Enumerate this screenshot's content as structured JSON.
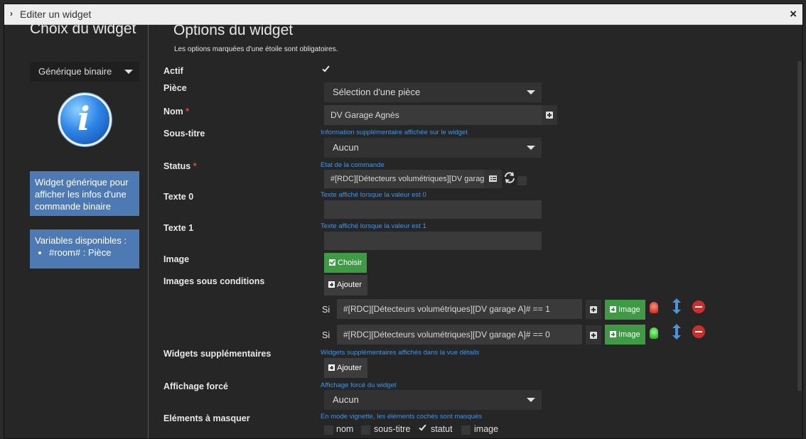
{
  "window": {
    "title": "Editer un widget"
  },
  "left": {
    "heading": "Choix du widget",
    "widget_select": "Générique binaire",
    "description": "Widget générique pour afficher les infos d'une commande binaire",
    "vars_title": "Variables disponibles :",
    "vars_item": "#room# : Pièce"
  },
  "main": {
    "heading": "Options du widget",
    "note": "Les options marquées d'une étoile sont obligatoires.",
    "actif_label": "Actif",
    "piece_label": "Pièce",
    "piece_value": "Sélection d'une pièce",
    "nom_label": "Nom",
    "nom_value": "DV Garage Agnès",
    "required_star": "*",
    "soustitre_label": "Sous-titre",
    "soustitre_help": "Information supplémentaire affichée sur le widget",
    "soustitre_value": "Aucun",
    "status_label": "Status",
    "status_help": "Etat de la commande",
    "status_value": "#[RDC][Détecteurs volumétriques][DV garage A]#",
    "texte0_label": "Texte 0",
    "texte0_help": "Texte affiché lorsque la valeur est 0",
    "texte1_label": "Texte 1",
    "texte1_help": "Texte affiché lorsque la valeur est 1",
    "image_label": "Image",
    "choisir_label": "Choisir",
    "images_cond_label": "Images sous conditions",
    "ajouter_label": "Ajouter",
    "si_label": "Si",
    "cond1": "#[RDC][Détecteurs volumétriques][DV garage A]# == 1",
    "cond2": "#[RDC][Détecteurs volumétriques][DV garage A]# == 0",
    "image_btn": "Image",
    "widgets_supp_label": "Widgets supplémentaires",
    "widgets_supp_help": "Widgets supplémentaires affichés dans la vue détails",
    "affichage_label": "Affichage forcé",
    "affichage_help": "Affichage forcé du widget",
    "affichage_value": "Aucun",
    "masquer_label": "Eléments à masquer",
    "masquer_help": "En mode vignette, les éléments cochés sont masqués",
    "opt_nom": "nom",
    "opt_soustitre": "sous-titre",
    "opt_statut": "statut",
    "opt_image": "image"
  }
}
